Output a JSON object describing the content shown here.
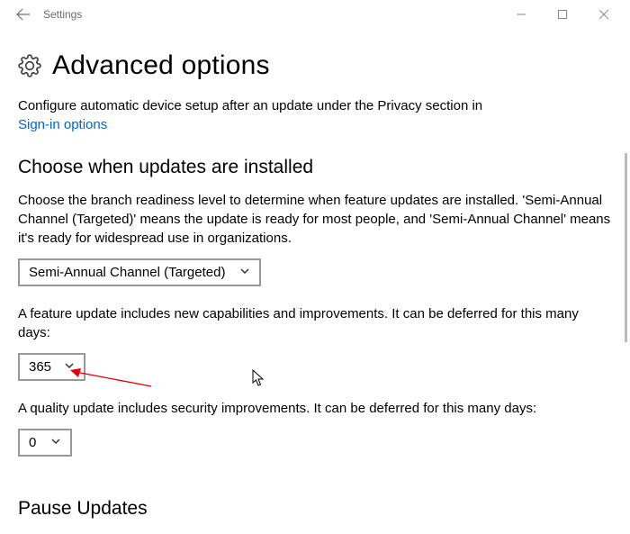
{
  "window": {
    "title": "Settings"
  },
  "page": {
    "heading": "Advanced options",
    "intro": "Configure automatic device setup after an update under the Privacy section in",
    "signin_link": "Sign-in options"
  },
  "section1": {
    "heading": "Choose when updates are installed",
    "desc": "Choose the branch readiness level to determine when feature updates are installed. 'Semi-Annual Channel (Targeted)' means the update is ready for most people, and 'Semi-Annual Channel' means it's ready for widespread use in organizations.",
    "branch_value": "Semi-Annual Channel (Targeted)",
    "feature_desc": "A feature update includes new capabilities and improvements. It can be deferred for this many days:",
    "feature_days": "365",
    "quality_desc": "A quality update includes security improvements. It can be deferred for this many days:",
    "quality_days": "0"
  },
  "section2": {
    "heading": "Pause Updates"
  }
}
